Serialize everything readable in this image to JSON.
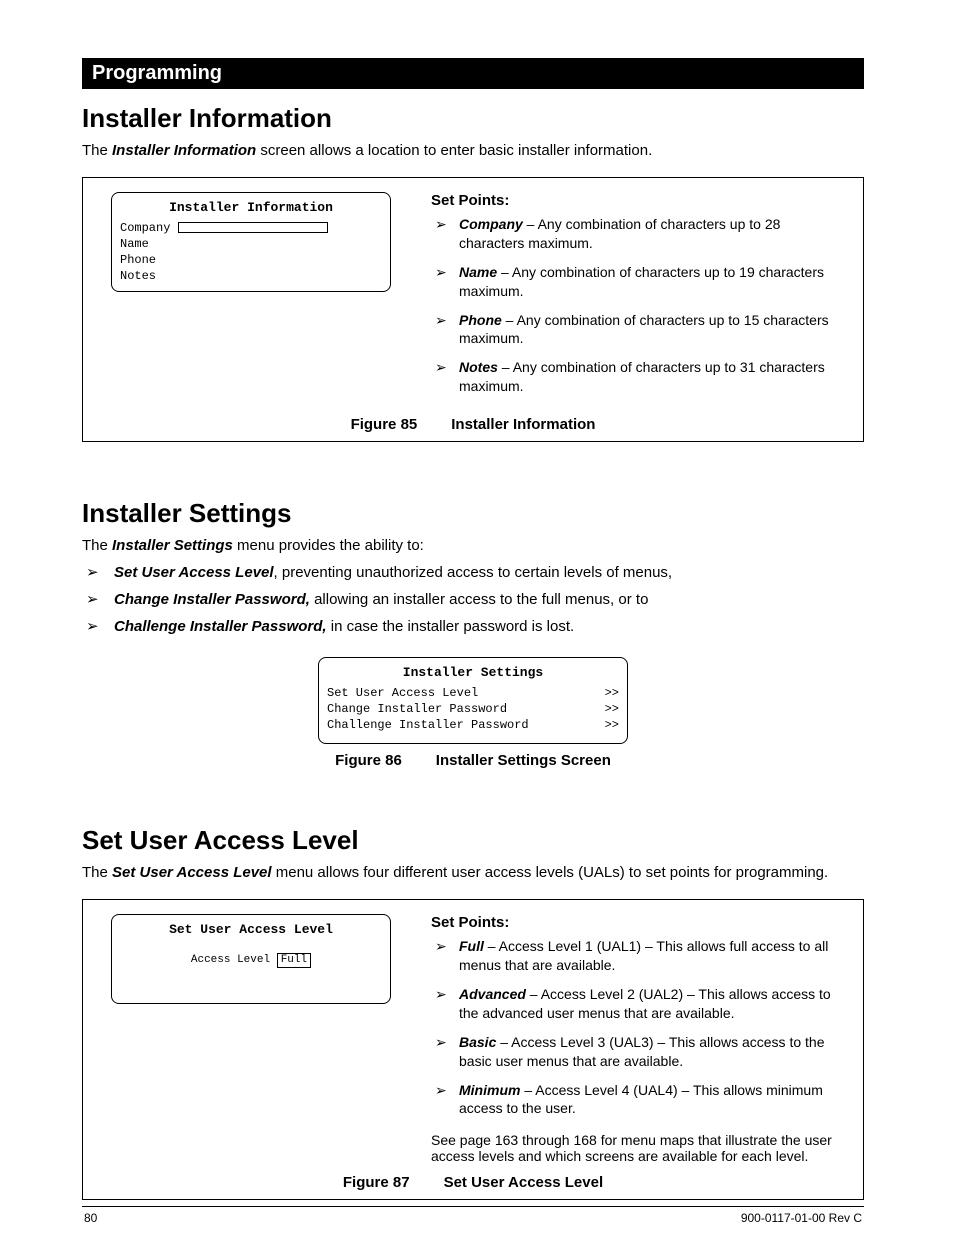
{
  "banner": "Programming",
  "section1": {
    "heading": "Installer Information",
    "lead_pre": "The ",
    "lead_term": "Installer Information",
    "lead_post": " screen allows a location to enter basic installer information.",
    "screen": {
      "title": "Installer Information",
      "rows": [
        "Company",
        "Name",
        "Phone",
        "Notes"
      ]
    },
    "setpoints_heading": "Set Points:",
    "setpoints": [
      {
        "term": "Company",
        "rest": " – Any combination of characters up to 28 characters maximum."
      },
      {
        "term": "Name",
        "rest": " – Any combination of characters up to 19 characters maximum."
      },
      {
        "term": "Phone",
        "rest": " – Any combination of characters up to 15 characters maximum."
      },
      {
        "term": "Notes",
        "rest": " – Any combination of characters up to 31 characters maximum."
      }
    ],
    "caption_no": "Figure 85",
    "caption_title": "Installer Information"
  },
  "section2": {
    "heading": "Installer Settings",
    "lead_pre": "The ",
    "lead_term": "Installer Settings",
    "lead_post": " menu provides the ability to:",
    "items": [
      {
        "term": "Set User Access Level",
        "rest": ", preventing unauthorized access to certain levels of menus,"
      },
      {
        "term": "Change Installer Password,",
        "rest": " allowing an installer access to the full menus, or to"
      },
      {
        "term": "Challenge Installer Password,",
        "rest": " in case the installer password is lost."
      }
    ],
    "screen": {
      "title": "Installer Settings",
      "rows": [
        {
          "label": "Set User Access Level",
          "arrow": ">>"
        },
        {
          "label": "Change Installer Password",
          "arrow": ">>"
        },
        {
          "label": "Challenge Installer Password",
          "arrow": ">>"
        }
      ]
    },
    "caption_no": "Figure 86",
    "caption_title": "Installer Settings Screen"
  },
  "section3": {
    "heading": "Set User Access Level",
    "lead_pre": "The ",
    "lead_term": "Set User Access Level",
    "lead_post": " menu allows four different user access levels (UALs) to set points for programming.",
    "screen": {
      "title": "Set User Access Level",
      "label": "Access Level",
      "value": "Full"
    },
    "setpoints_heading": "Set Points:",
    "setpoints": [
      {
        "term": "Full",
        "rest": " – Access Level 1 (UAL1) – This allows full access to all menus that are available."
      },
      {
        "term": "Advanced",
        "rest": " – Access Level 2 (UAL2) – This allows access to the advanced user menus that are available."
      },
      {
        "term": "Basic",
        "rest": " – Access Level 3 (UAL3) – This allows access to the basic user menus that are available."
      },
      {
        "term": "Minimum",
        "rest": " – Access Level 4 (UAL4) – This allows minimum access to the user."
      }
    ],
    "footnote": "See page 163 through 168 for menu maps that illustrate the user access levels and which screens are available for each level.",
    "caption_no": "Figure 87",
    "caption_title": "Set User Access Level"
  },
  "footer": {
    "page": "80",
    "doc": "900-0117-01-00 Rev C"
  }
}
